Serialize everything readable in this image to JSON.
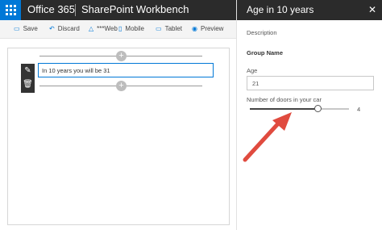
{
  "suitebar": {
    "brand": "Office 365",
    "app_title": "SharePoint Workbench"
  },
  "toolbar": {
    "save_label": "Save",
    "discard_label": "Discard",
    "web_label": "***Web",
    "mobile_label": "Mobile",
    "tablet_label": "Tablet",
    "preview_label": "Preview"
  },
  "canvas": {
    "webpart_text": "In 10 years you will be 31"
  },
  "pane": {
    "title": "Age in 10 years",
    "description_label": "Description",
    "group_name": "Group Name",
    "age_label": "Age",
    "age_value": "21",
    "doors_label": "Number of doors in your car",
    "doors_value": "4",
    "doors_fraction": 0.68
  },
  "colors": {
    "accent": "#0078d7",
    "suitebar": "#2b2b2b",
    "annotation_arrow": "#e04b3f"
  },
  "icons": {
    "waffle": "waffle-icon",
    "save": "save-icon",
    "discard": "undo-icon",
    "web": "web-icon",
    "mobile": "mobile-icon",
    "tablet": "tablet-icon",
    "preview": "eye-icon",
    "edit": "pencil-icon",
    "delete": "trash-icon",
    "add": "plus-icon",
    "close": "close-icon"
  }
}
